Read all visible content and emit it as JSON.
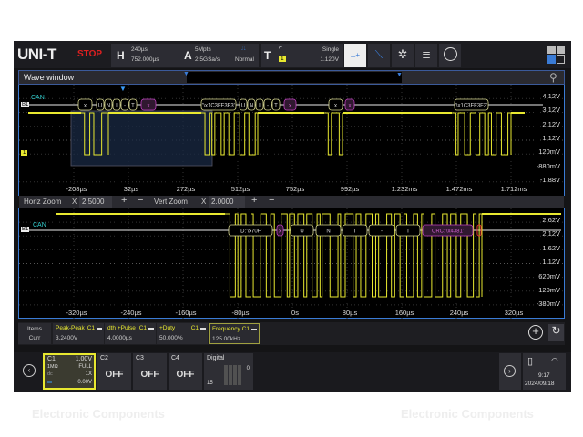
{
  "header": {
    "logo": "UNI-T",
    "run_state": "STOP",
    "horiz_label": "H",
    "time_base": "240µs",
    "h_position": "752.000µs",
    "acq_label": "A",
    "memory_depth": "5Mpts",
    "sample_rate": "2.5GSa/s",
    "acq_mode": "Normal",
    "trig_label": "T",
    "trig_source": "1",
    "trig_mode": "Single",
    "trig_level": "1.120V"
  },
  "toolbar_icons": [
    "cursor-measure-icon",
    "trend-icon",
    "pattern-icon",
    "histogram-icon",
    "search-icon",
    "layout-grid-icon"
  ],
  "wave_window": {
    "title": "Wave window"
  },
  "upper_plot": {
    "bus_label": "CAN",
    "bus_marker": "B1",
    "channel_marker": "1",
    "volt_labels": [
      "4.12V",
      "3.12V",
      "2.12V",
      "1.12V",
      "120mV",
      "-880mV",
      "-1.88V"
    ],
    "time_labels": [
      "-208µs",
      "32µs",
      "272µs",
      "512µs",
      "752µs",
      "992µs",
      "1.232ms",
      "1.472ms",
      "1.712ms"
    ],
    "packets": [
      "x",
      "U",
      "N",
      "I",
      "-",
      "T",
      "x",
      "'\\x1C3FF3F3'",
      "U",
      "N",
      "I",
      "-",
      "T",
      "x",
      "x",
      "x",
      "'\\x1C3FF3F3'"
    ]
  },
  "zoom_bar": {
    "horiz_label": "Horiz Zoom",
    "horiz_x": "X",
    "horiz_value": "2.5000",
    "vert_label": "Vert Zoom",
    "vert_x": "X",
    "vert_value": "2.0000",
    "plus": "+",
    "minus": "−"
  },
  "lower_plot": {
    "bus_label": "CAN",
    "bus_marker": "B1",
    "volt_labels": [
      "2.62V",
      "2.12V",
      "1.62V",
      "1.12V",
      "620mV",
      "120mV",
      "-380mV"
    ],
    "time_labels": [
      "-320µs",
      "-240µs",
      "-160µs",
      "-80µs",
      "0s",
      "80µs",
      "160µs",
      "240µs",
      "320µs"
    ],
    "packets": [
      "ID:'\\x70F'",
      "x",
      "U",
      "N",
      "I",
      "-",
      "T",
      "CRC:'\\x4381'"
    ]
  },
  "measurements": {
    "row_labels": [
      "Items",
      "Curr"
    ],
    "items": [
      {
        "name": "Peak-Peak",
        "src": "C1",
        "value": "3.2400V"
      },
      {
        "name": "dth +Pulse",
        "src": "C1",
        "value": "4.0000µs"
      },
      {
        "name": "+Duty",
        "src": "C1",
        "value": "50.000%"
      },
      {
        "name": "Frequency",
        "src": "C1",
        "value": "125.00kHz"
      }
    ]
  },
  "channels": {
    "c1": {
      "name": "C1",
      "scale": "1.00V",
      "impedance": "1MΩ",
      "bandwidth": "FULL",
      "coupling": "dc",
      "probe": "1X",
      "offset": "0.00V"
    },
    "c2": {
      "name": "C2",
      "state": "OFF"
    },
    "c3": {
      "name": "C3",
      "state": "OFF"
    },
    "c4": {
      "name": "C4",
      "state": "OFF"
    },
    "digital": {
      "name": "Digital",
      "hi": "0",
      "lo": "15"
    }
  },
  "status": {
    "time": "9:17",
    "date": "2024/09/18"
  },
  "watermark": "Electronic Components",
  "colors": {
    "channel1": "#e8e830",
    "bus": "#bbbbbb",
    "accent": "#3a7bd5",
    "stop": "#e02020",
    "crc": "#c040c0"
  }
}
